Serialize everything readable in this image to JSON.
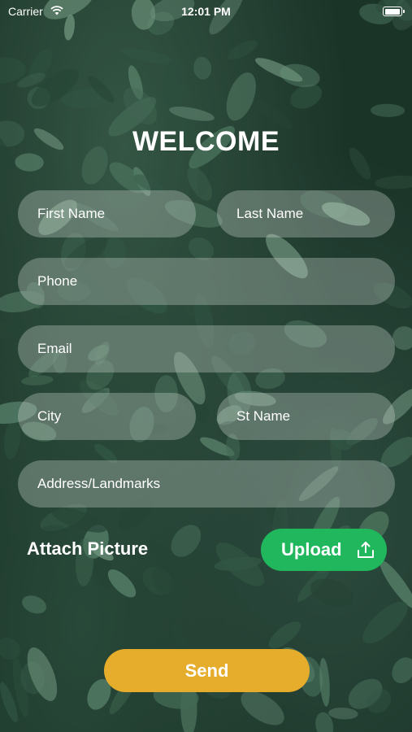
{
  "status_bar": {
    "carrier": "Carrier",
    "time": "12:01 PM"
  },
  "title": "WELCOME",
  "form": {
    "first_name_placeholder": "First Name",
    "last_name_placeholder": "Last Name",
    "phone_placeholder": "Phone",
    "email_placeholder": "Email",
    "city_placeholder": "City",
    "street_placeholder": "St Name",
    "address_placeholder": "Address/Landmarks"
  },
  "attach": {
    "label": "Attach Picture",
    "upload_label": "Upload",
    "upload_icon": "upload-icon"
  },
  "send_label": "Send",
  "colors": {
    "upload": "#20b75d",
    "send": "#e6ac2b",
    "field_bg": "rgba(205,215,210,0.33)",
    "text": "#ffffff"
  }
}
